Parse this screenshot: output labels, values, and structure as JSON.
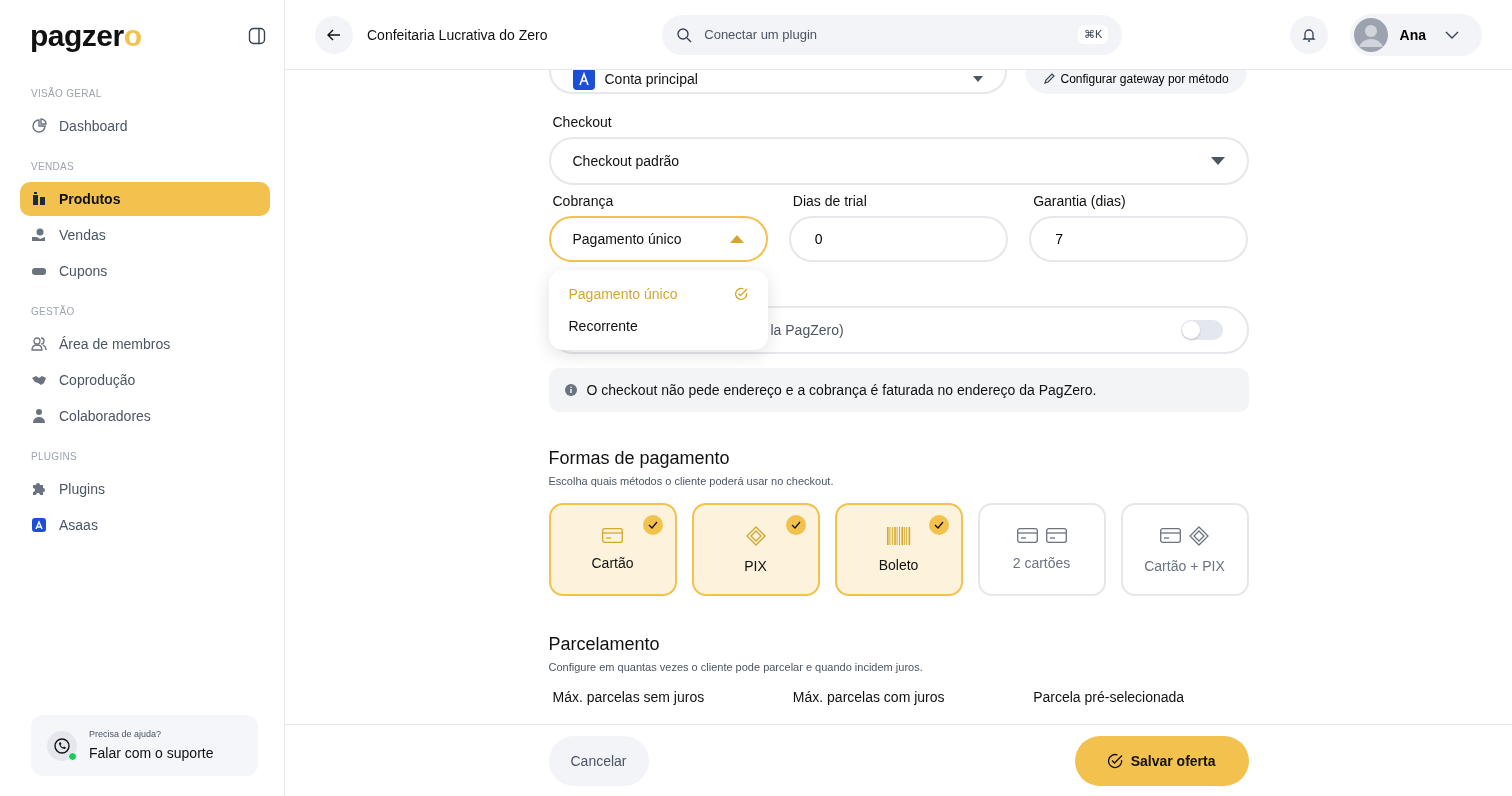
{
  "sidebar": {
    "logo": "pagzero",
    "sections": [
      {
        "title": "VISÃO GERAL",
        "items": [
          {
            "label": "Dashboard",
            "kind": "chart",
            "selected": false
          }
        ]
      },
      {
        "title": "VENDAS",
        "items": [
          {
            "label": "Produtos",
            "kind": "box",
            "selected": true
          },
          {
            "label": "Vendas",
            "kind": "hand",
            "selected": false
          },
          {
            "label": "Cupons",
            "kind": "ticket",
            "selected": false
          }
        ]
      },
      {
        "title": "GESTÃO",
        "items": [
          {
            "label": "Área de membros",
            "kind": "users",
            "selected": false
          },
          {
            "label": "Coprodução",
            "kind": "handshake",
            "selected": false
          },
          {
            "label": "Colaboradores",
            "kind": "person",
            "selected": false
          }
        ]
      },
      {
        "title": "PLUGINS",
        "items": [
          {
            "label": "Plugins",
            "kind": "puzzle",
            "selected": false
          },
          {
            "label": "Asaas",
            "kind": "asaas",
            "selected": false
          }
        ]
      }
    ],
    "help": {
      "caption": "Precisa de ajuda?",
      "link": "Falar com o suporte"
    }
  },
  "header": {
    "title": "Confeitaria Lucrativa do Zero",
    "search": {
      "placeholder": "Conectar um plugin",
      "shortcut": "⌘K"
    },
    "user": "Ana"
  },
  "form": {
    "account": {
      "value": "Conta principal"
    },
    "gateway_button": "Configurar gateway por método",
    "checkout": {
      "label": "Checkout",
      "value": "Checkout padrão"
    },
    "billing": {
      "label": "Cobrança",
      "value": "Pagamento único",
      "expanded": true,
      "options": [
        {
          "label": "Pagamento único",
          "selected": true
        },
        {
          "label": "Recorrente",
          "selected": false
        }
      ]
    },
    "trial": {
      "label": "Dias de trial",
      "value": "0"
    },
    "warranty": {
      "label": "Garantia (dias)",
      "value": "7"
    },
    "address_toggle": {
      "label": "la PagZero)",
      "on": false
    },
    "info": "O checkout não pede endereço e a cobrança é faturada no endereço da PagZero.",
    "payment": {
      "title": "Formas de pagamento",
      "subtitle": "Escolha quais métodos o cliente poderá usar no checkout.",
      "methods": [
        {
          "label": "Cartão",
          "kind": "card",
          "selected": true
        },
        {
          "label": "PIX",
          "kind": "pix",
          "selected": true
        },
        {
          "label": "Boleto",
          "kind": "barcode",
          "selected": true
        },
        {
          "label": "2 cartões",
          "kind": "two-cards",
          "selected": false
        },
        {
          "label": "Cartão + PIX",
          "kind": "card-pix",
          "selected": false
        }
      ]
    },
    "installments": {
      "title": "Parcelamento",
      "subtitle": "Configure em quantas vezes o cliente pode parcelar e quando incidem juros.",
      "labels": [
        "Máx. parcelas sem juros",
        "Máx. parcelas com juros",
        "Parcela pré-selecionada"
      ]
    }
  },
  "footer": {
    "cancel": "Cancelar",
    "save": "Salvar oferta"
  }
}
